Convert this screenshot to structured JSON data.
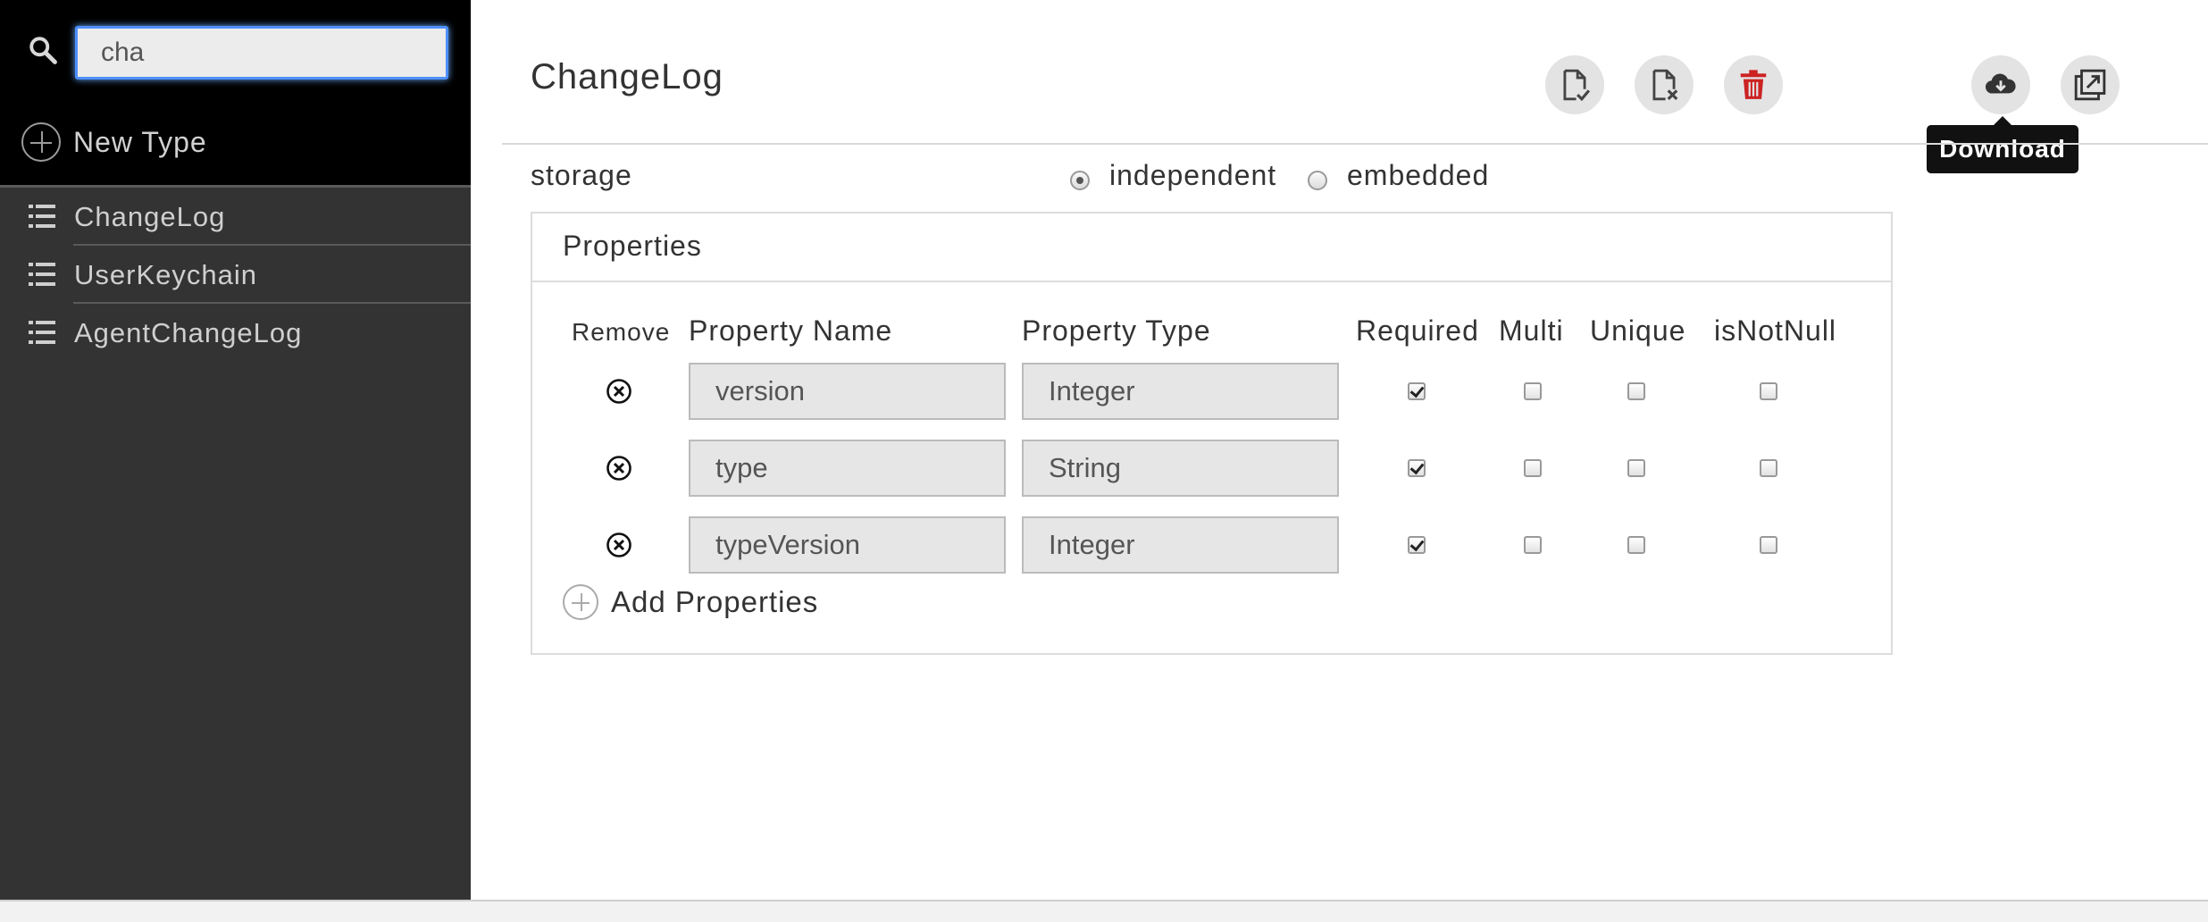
{
  "sidebar": {
    "search": {
      "value": "cha",
      "placeholder": ""
    },
    "new_type_label": "New Type",
    "items": [
      {
        "label": "ChangeLog"
      },
      {
        "label": "UserKeychain"
      },
      {
        "label": "AgentChangeLog"
      }
    ]
  },
  "main": {
    "title": "ChangeLog",
    "toolbar": {
      "save_icon": "file-check-icon",
      "discard_icon": "file-x-icon",
      "delete_icon": "trash-icon",
      "download_icon": "cloud-download-icon",
      "export_icon": "export-images-icon",
      "tooltip": "Download"
    },
    "storage": {
      "label": "storage",
      "options": [
        {
          "label": "independent",
          "selected": true
        },
        {
          "label": "embedded",
          "selected": false
        }
      ]
    },
    "properties": {
      "title": "Properties",
      "headers": {
        "remove": "Remove",
        "name": "Property Name",
        "type": "Property Type",
        "required": "Required",
        "multi": "Multi",
        "unique": "Unique",
        "not_null": "isNotNull"
      },
      "rows": [
        {
          "name": "version",
          "type": "Integer",
          "required": true,
          "multi": false,
          "unique": false,
          "not_null": false
        },
        {
          "name": "type",
          "type": "String",
          "required": true,
          "multi": false,
          "unique": false,
          "not_null": false
        },
        {
          "name": "typeVersion",
          "type": "Integer",
          "required": true,
          "multi": false,
          "unique": false,
          "not_null": false
        }
      ],
      "add_label": "Add Properties"
    }
  },
  "colors": {
    "sidebar_bg": "#333333",
    "sidebar_top_bg": "#000000",
    "focus_border": "#4d90fe",
    "delete_red": "#cc2222",
    "footer_link": "#f08c00"
  }
}
